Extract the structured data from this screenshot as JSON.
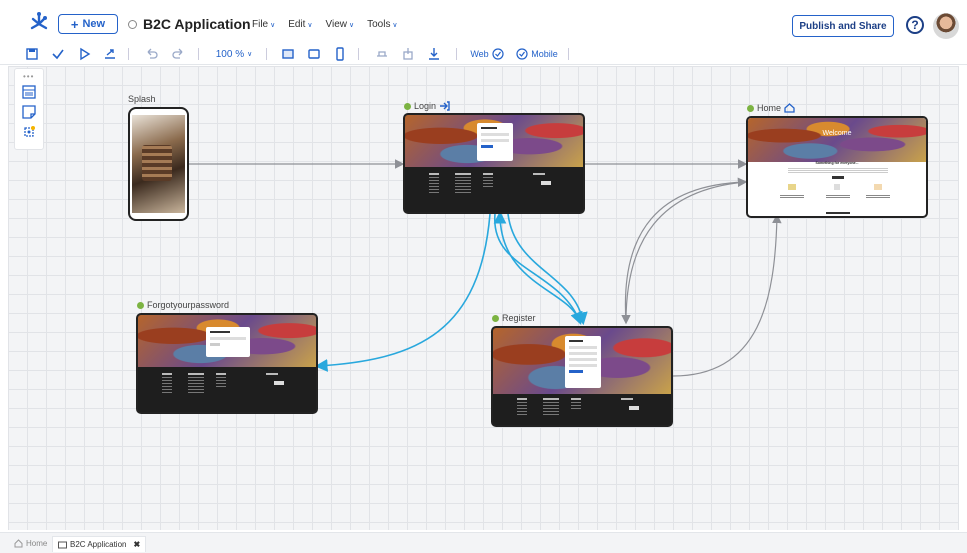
{
  "header": {
    "new_label": "New",
    "app_title": "B2C Application",
    "menus": [
      "File",
      "Edit",
      "View",
      "Tools"
    ],
    "publish_label": "Publish and Share",
    "help_symbol": "?"
  },
  "toolbar": {
    "zoom": "100 %",
    "web_label": "Web",
    "mobile_label": "Mobile"
  },
  "nodes": {
    "splash": "Splash",
    "login": "Login",
    "home": "Home",
    "forgot": "Forgotyourpassword",
    "register": "Register"
  },
  "home_preview": {
    "welcome": "Welcome",
    "section": "Something for everyone..."
  },
  "tabs": {
    "home": "Home",
    "app": "B2C Application"
  },
  "colors": {
    "accent": "#2462c9",
    "link_arrow": "#29a8dd",
    "flow_arrow": "#8e9096",
    "status_dot": "#7cb342"
  }
}
